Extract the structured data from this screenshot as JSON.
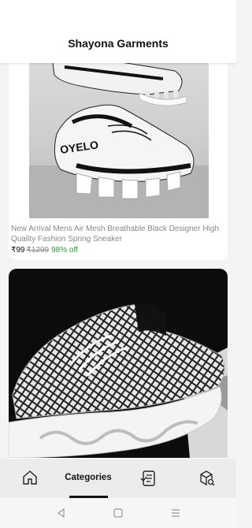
{
  "header": {
    "title": "Shayona Garments",
    "cart_count": "0"
  },
  "products": [
    {
      "name": "New Arrival Mens Air Mesh Breathable Black Designer High Quality Fashion Spring Sneaker",
      "price": "₹99",
      "mrp": "₹1299",
      "discount": "98% off"
    }
  ],
  "bottom_nav": {
    "items": [
      {
        "icon": "home-icon"
      },
      {
        "label": "Categories"
      },
      {
        "icon": "orders-icon"
      },
      {
        "icon": "package-search-icon"
      }
    ]
  },
  "system_nav": {
    "icons": [
      "back-icon",
      "home-square-icon",
      "menu-icon"
    ]
  },
  "colors": {
    "discount_green": "#2e9b3a",
    "header_bg": "#ffffff",
    "page_bg": "#f4f4f4",
    "nav_bg": "#ececec"
  }
}
